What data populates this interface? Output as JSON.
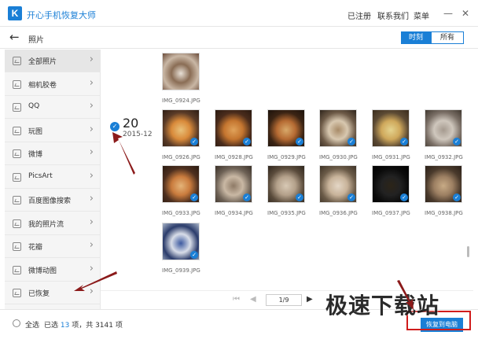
{
  "window": {
    "title": "开心手机恢复大师",
    "links": [
      "已注册",
      "联系我们",
      "菜单"
    ],
    "colors": {
      "accent": "#1a7fd6",
      "annotation": "#8b1a1a",
      "highlight": "#d01c1c"
    }
  },
  "nav": {
    "title": "照片",
    "tabs": [
      {
        "label": "时刻",
        "active": true
      },
      {
        "label": "所有",
        "active": false
      }
    ]
  },
  "sidebar": {
    "items": [
      {
        "label": "全部照片",
        "active": true
      },
      {
        "label": "相机胶卷"
      },
      {
        "label": "QQ"
      },
      {
        "label": "玩图"
      },
      {
        "label": "微博"
      },
      {
        "label": "PicsArt"
      },
      {
        "label": "百度图像搜索"
      },
      {
        "label": "我的照片流"
      },
      {
        "label": "花瓣"
      },
      {
        "label": "微博动图"
      },
      {
        "label": "已恢复"
      }
    ]
  },
  "main": {
    "date": {
      "day": "20",
      "month": "2015-12"
    },
    "photos": [
      {
        "name": "IMG_0924.JPG"
      },
      {
        "name": "IMG_0926.JPG"
      },
      {
        "name": "IMG_0928.JPG"
      },
      {
        "name": "IMG_0929.JPG"
      },
      {
        "name": "IMG_0930.JPG"
      },
      {
        "name": "IMG_0931.JPG"
      },
      {
        "name": "IMG_0932.JPG"
      },
      {
        "name": "IMG_0933.JPG"
      },
      {
        "name": "IMG_0934.JPG"
      },
      {
        "name": "IMG_0935.JPG"
      },
      {
        "name": "IMG_0936.JPG"
      },
      {
        "name": "IMG_0937.JPG"
      },
      {
        "name": "IMG_0938.JPG"
      },
      {
        "name": "IMG_0939.JPG"
      }
    ]
  },
  "pager": {
    "page": "1/9"
  },
  "footer": {
    "select_all": "全选",
    "selected_prefix": "已选",
    "selected_count": "13",
    "selected_suffix": "项，共 3141 项",
    "recover_button": "恢复到电脑"
  },
  "watermark": "极速下载站"
}
